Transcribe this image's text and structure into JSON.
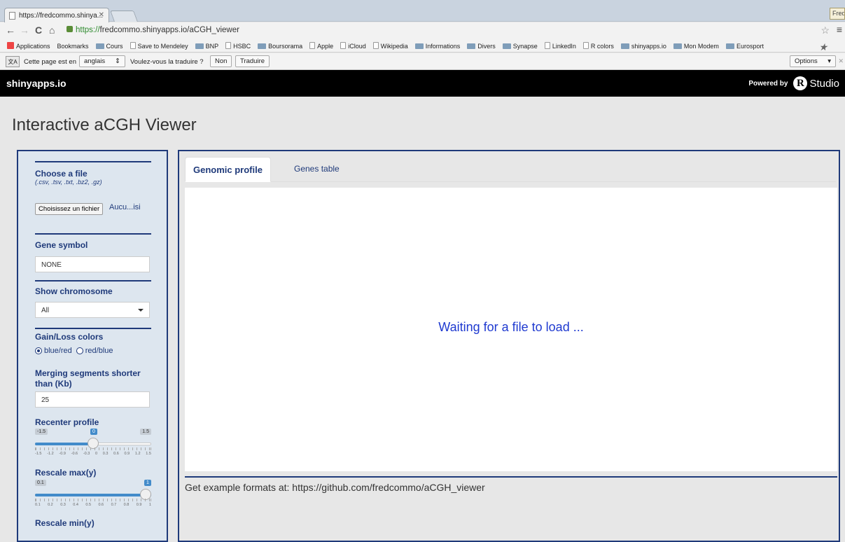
{
  "browser": {
    "tab_title": "https://fredcommo.shinya...",
    "user": "Fred",
    "url_https": "https://",
    "url_rest": "fredcommo.shinyapps.io/aCGH_viewer",
    "bookmarks": [
      {
        "label": "Applications",
        "icon": "apps-grid-icon"
      },
      {
        "label": "Bookmarks",
        "icon": "star-icon"
      },
      {
        "label": "Cours",
        "icon": "folder-icon"
      },
      {
        "label": "Save to Mendeley",
        "icon": "page-icon"
      },
      {
        "label": "BNP",
        "icon": "bnp-icon"
      },
      {
        "label": "HSBC",
        "icon": "page-icon"
      },
      {
        "label": "Boursorama",
        "icon": "boursorama-icon"
      },
      {
        "label": "Apple",
        "icon": "page-icon"
      },
      {
        "label": "iCloud",
        "icon": "page-icon"
      },
      {
        "label": "Wikipedia",
        "icon": "page-icon"
      },
      {
        "label": "Informations",
        "icon": "folder-icon"
      },
      {
        "label": "Divers",
        "icon": "folder-icon"
      },
      {
        "label": "Synapse",
        "icon": "synapse-icon"
      },
      {
        "label": "LinkedIn",
        "icon": "page-icon"
      },
      {
        "label": "R colors",
        "icon": "page-icon"
      },
      {
        "label": "shinyapps.io",
        "icon": "shinyapps-icon"
      },
      {
        "label": "Mon Modem",
        "icon": "tools-icon"
      },
      {
        "label": "Eurosport",
        "icon": "eurosport-icon"
      }
    ]
  },
  "translate_bar": {
    "prefix": "Cette page est en",
    "language": "anglais",
    "question": "Voulez-vous la traduire ?",
    "no": "Non",
    "translate": "Traduire",
    "options": "Options"
  },
  "header": {
    "brand": "shinyapps.io",
    "powered_by": "Powered by",
    "r": "R",
    "studio": "Studio"
  },
  "page": {
    "title": "Interactive aCGH Viewer"
  },
  "sidebar": {
    "file_label": "Choose a file",
    "file_hint": "(.csv, .tsv, .txt, .bz2, .gz)",
    "file_button": "Choisissez un fichier",
    "file_name": "Aucu...isi",
    "gene_label": "Gene symbol",
    "gene_value": "NONE",
    "chrom_label": "Show chromosome",
    "chrom_value": "All",
    "colors_label": "Gain/Loss colors",
    "color_opt1": "blue/red",
    "color_opt2": "red/blue",
    "color_selected": "blue/red",
    "merge_label": "Merging segments shorter than (Kb)",
    "merge_value": "25",
    "recenter_label": "Recenter profile",
    "recenter_min": "-1.5",
    "recenter_max": "1.5",
    "recenter_val": "0",
    "recenter_ticks": [
      "-1.5",
      "-1.2",
      "-0.9",
      "-0.6",
      "-0.3",
      "0",
      "0.3",
      "0.6",
      "0.9",
      "1.2",
      "1.5"
    ],
    "recenter_fraction": 0.5,
    "rescale_max_label": "Rescale max(y)",
    "rescale_max_min": "0.1",
    "rescale_max_val": "1",
    "rescale_max_ticks": [
      "0.1",
      "0.2",
      "0.3",
      "0.4",
      "0.5",
      "0.6",
      "0.7",
      "0.8",
      "0.9",
      "1"
    ],
    "rescale_max_fraction": 1.0,
    "rescale_min_label": "Rescale min(y)"
  },
  "main": {
    "tab_active": "Genomic profile",
    "tab_other": "Genes table",
    "waiting": "Waiting for a file to load ...",
    "footer": "Get example formats at: https://github.com/fredcommo/aCGH_viewer"
  },
  "colors": {
    "accent": "#1f3a7a",
    "slider": "#428bca",
    "waiting_text": "#1f3ad0"
  }
}
